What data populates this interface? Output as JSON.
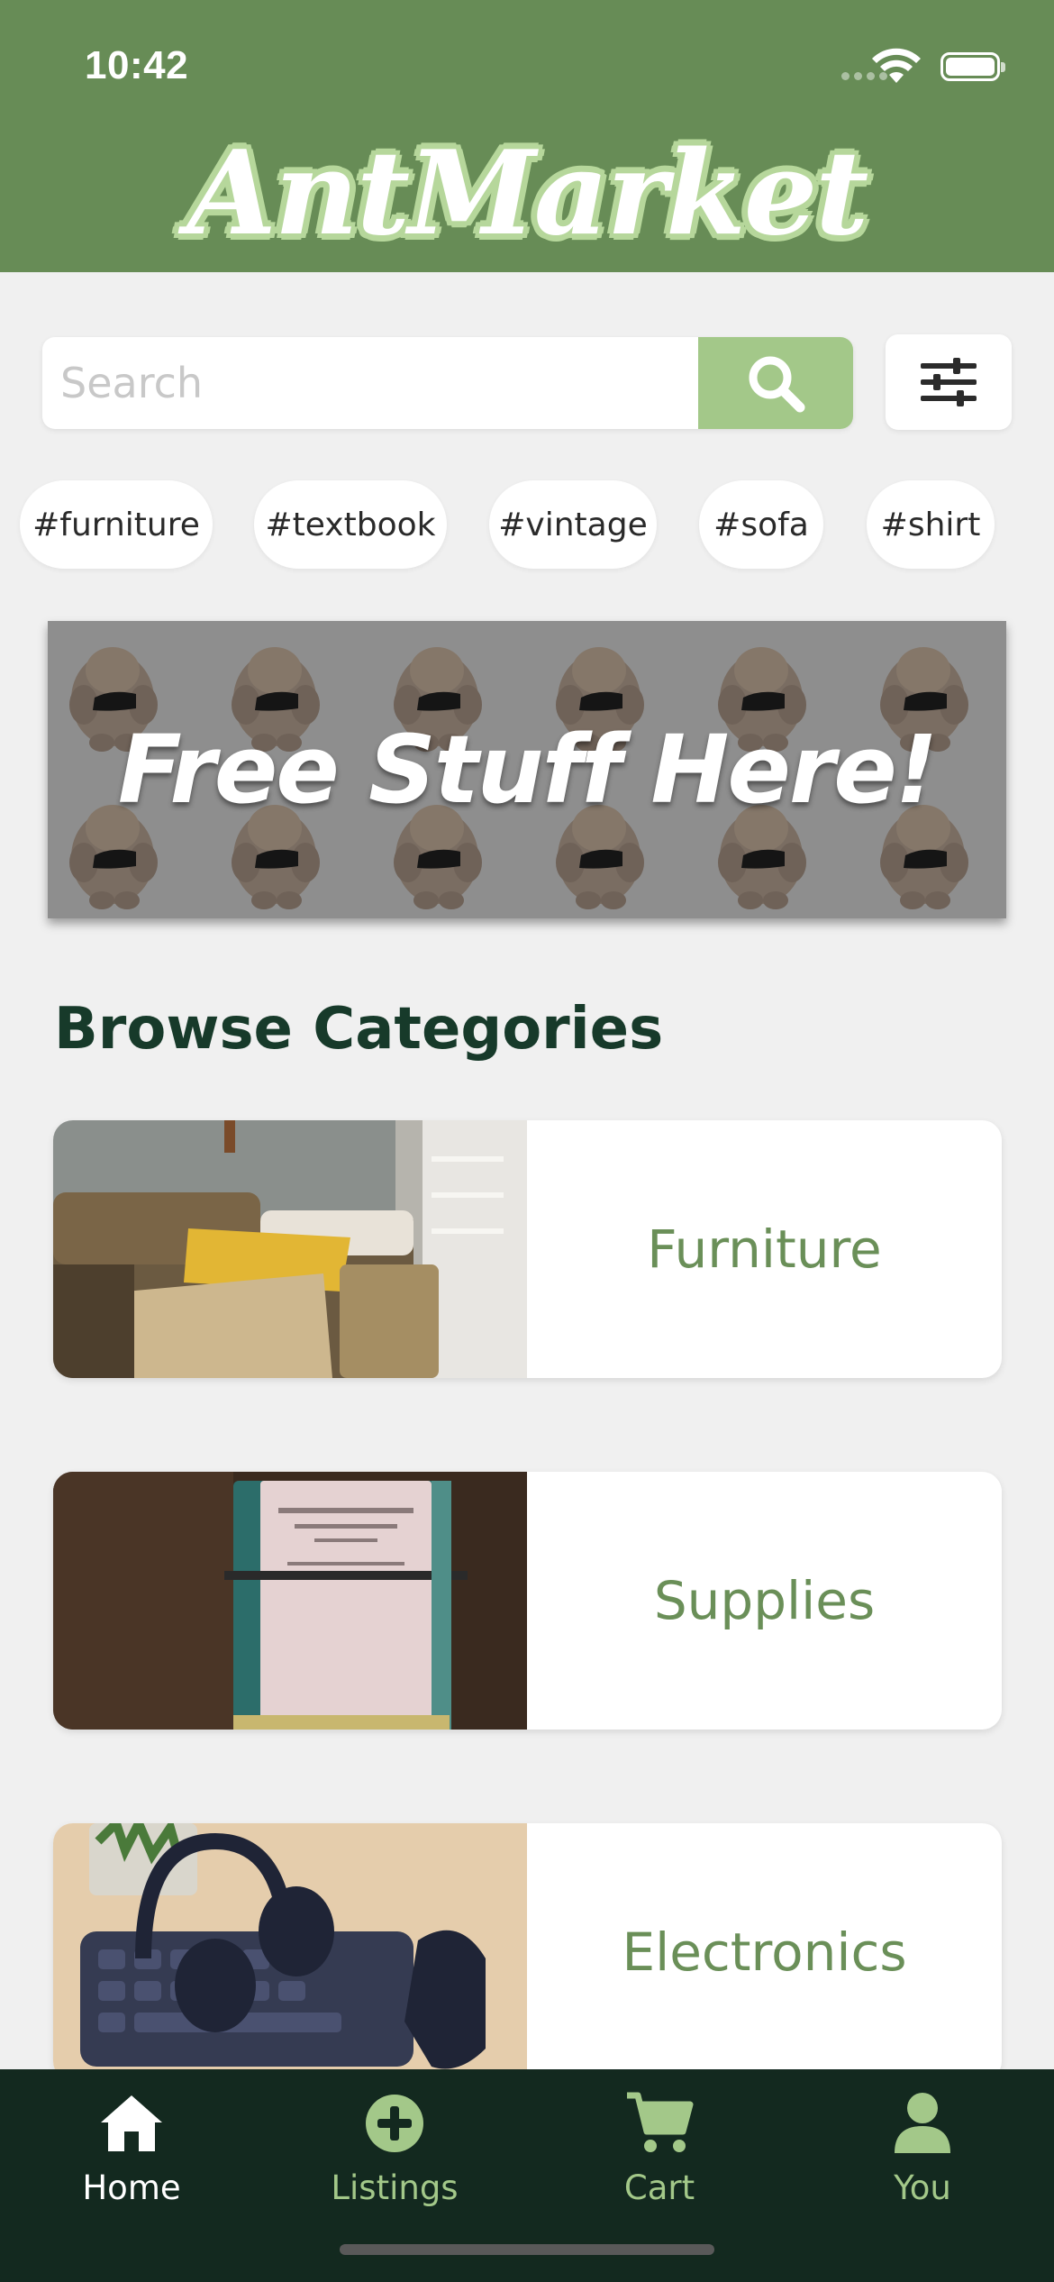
{
  "status_bar": {
    "time": "10:42"
  },
  "app": {
    "name": "AntMarket"
  },
  "search": {
    "placeholder": "Search"
  },
  "tags": [
    "#furniture",
    "#textbook",
    "#vintage",
    "#sofa",
    "#shirt"
  ],
  "banner": {
    "text": "Free Stuff Here!"
  },
  "section": {
    "title": "Browse Categories"
  },
  "categories": [
    {
      "label": "Furniture",
      "image": "sofa-pillows-photo"
    },
    {
      "label": "Supplies",
      "image": "old-book-photo"
    },
    {
      "label": "Electronics",
      "image": "headphones-keyboard-photo"
    }
  ],
  "nav": {
    "items": [
      {
        "label": "Home",
        "icon": "house-icon",
        "active": true
      },
      {
        "label": "Listings",
        "icon": "plus-circle-icon",
        "active": false
      },
      {
        "label": "Cart",
        "icon": "cart-icon",
        "active": false
      },
      {
        "label": "You",
        "icon": "person-icon",
        "active": false
      }
    ]
  },
  "colors": {
    "header": "#678c56",
    "accent": "#a3c889",
    "nav_background": "#13291f",
    "nav_active": "#ffffff",
    "nav_inactive": "#a3c889",
    "category_text": "#6a8f58",
    "title_text": "#173a2a"
  }
}
